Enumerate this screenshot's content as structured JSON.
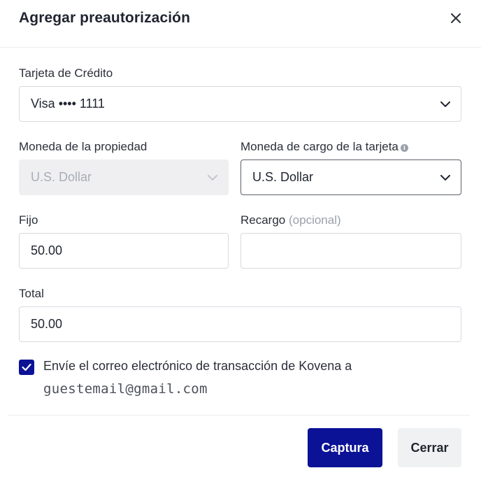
{
  "dialog": {
    "title": "Agregar preautorización",
    "close_icon": "close-icon"
  },
  "card": {
    "label": "Tarjeta de Crédito",
    "value": "Visa •••• 1111"
  },
  "property_currency": {
    "label": "Moneda de la propiedad",
    "value": "U.S. Dollar",
    "disabled": true
  },
  "charge_currency": {
    "label": "Moneda de cargo de la tarjeta",
    "value": "U.S. Dollar",
    "info_icon": "info-icon"
  },
  "fixed": {
    "label": "Fijo",
    "value": "50.00"
  },
  "surcharge": {
    "label": "Recargo",
    "optional": "(opcional)",
    "value": ""
  },
  "total": {
    "label": "Total",
    "value": "50.00"
  },
  "email_option": {
    "checked": true,
    "text": "Envíe el correo electrónico de transacción de Kovena a",
    "email": "guestemail@gmail.com"
  },
  "actions": {
    "capture_label": "Captura",
    "close_label": "Cerrar"
  },
  "colors": {
    "primary": "#0b1296",
    "border": "#d7dae0",
    "disabled_bg": "#efeff1"
  }
}
